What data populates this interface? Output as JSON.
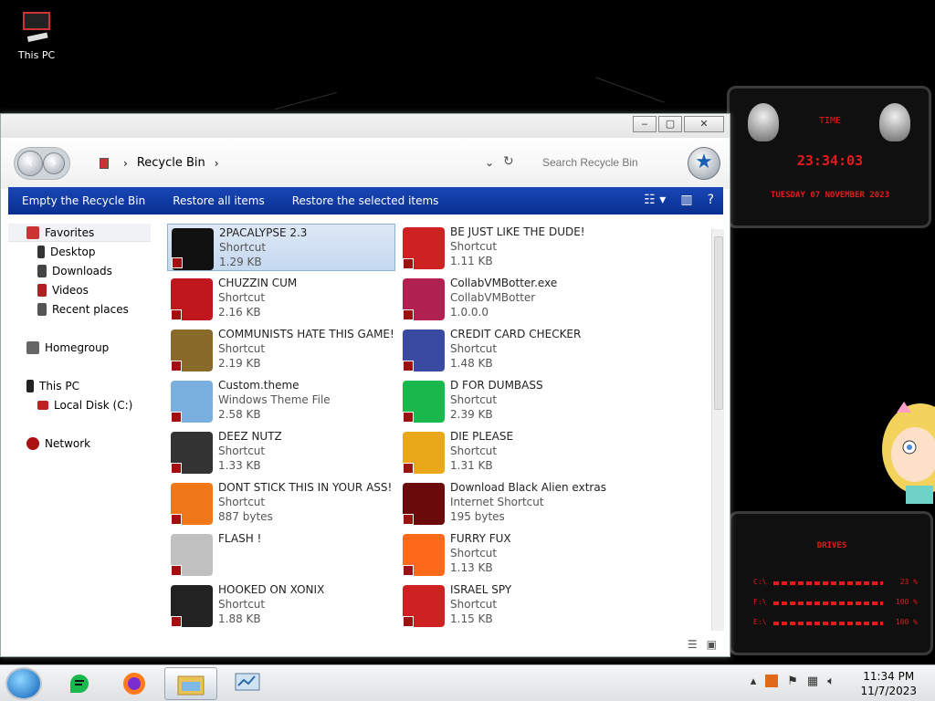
{
  "desktop": {
    "this_pc_label": "This PC"
  },
  "window": {
    "breadcrumb_location": "Recycle Bin",
    "search_placeholder": "Search Recycle Bin",
    "commands": [
      "Empty the Recycle Bin",
      "Restore all items",
      "Restore the selected items"
    ]
  },
  "nav": {
    "favorites": "Favorites",
    "desktop": "Desktop",
    "downloads": "Downloads",
    "videos": "Videos",
    "recent": "Recent places",
    "homegroup": "Homegroup",
    "this_pc": "This PC",
    "local_disk": "Local Disk (C:)",
    "network": "Network"
  },
  "files": [
    {
      "name": "2PACALYPSE 2.3",
      "type": "Shortcut",
      "size": "1.29 KB",
      "selected": true
    },
    {
      "name": "BE JUST LIKE THE DUDE!",
      "type": "Shortcut",
      "size": "1.11 KB"
    },
    {
      "name": "CHUZZIN CUM",
      "type": "Shortcut",
      "size": "2.16 KB"
    },
    {
      "name": "CollabVMBotter.exe",
      "type": "CollabVMBotter",
      "size": "1.0.0.0"
    },
    {
      "name": "COMMUNISTS HATE THIS GAME!",
      "type": "Shortcut",
      "size": "2.19 KB"
    },
    {
      "name": "CREDIT CARD CHECKER",
      "type": "Shortcut",
      "size": "1.48 KB"
    },
    {
      "name": "Custom.theme",
      "type": "Windows Theme File",
      "size": "2.58 KB"
    },
    {
      "name": "D FOR DUMBASS",
      "type": "Shortcut",
      "size": "2.39 KB"
    },
    {
      "name": "DEEZ NUTZ",
      "type": "Shortcut",
      "size": "1.33 KB"
    },
    {
      "name": "DIE PLEASE",
      "type": "Shortcut",
      "size": "1.31 KB"
    },
    {
      "name": "DONT STICK THIS IN YOUR ASS!",
      "type": "Shortcut",
      "size": "887 bytes"
    },
    {
      "name": "Download Black Alien extras",
      "type": "Internet Shortcut",
      "size": "195 bytes"
    },
    {
      "name": "FLASH !",
      "type": "",
      "size": ""
    },
    {
      "name": "FURRY FUX",
      "type": "Shortcut",
      "size": "1.13 KB"
    },
    {
      "name": "HOOKED ON XONIX",
      "type": "Shortcut",
      "size": "1.88 KB"
    },
    {
      "name": "ISRAEL SPY",
      "type": "Shortcut",
      "size": "1.15 KB"
    }
  ],
  "widgets": {
    "time_title": "TIME",
    "time_value": "23:34:03",
    "date_value": "TUESDAY 07 NOVEMBER 2023",
    "drives_title": "DRIVES",
    "drives": [
      {
        "label": "C:\\",
        "pct": "23 %"
      },
      {
        "label": "F:\\",
        "pct": "100 %"
      },
      {
        "label": "E:\\",
        "pct": "100 %"
      }
    ]
  },
  "taskbar": {
    "time": "11:34 PM",
    "date": "11/7/2023"
  },
  "colors": {
    "accent_blue": "#1847b6",
    "widget_red": "#e51b1b"
  }
}
